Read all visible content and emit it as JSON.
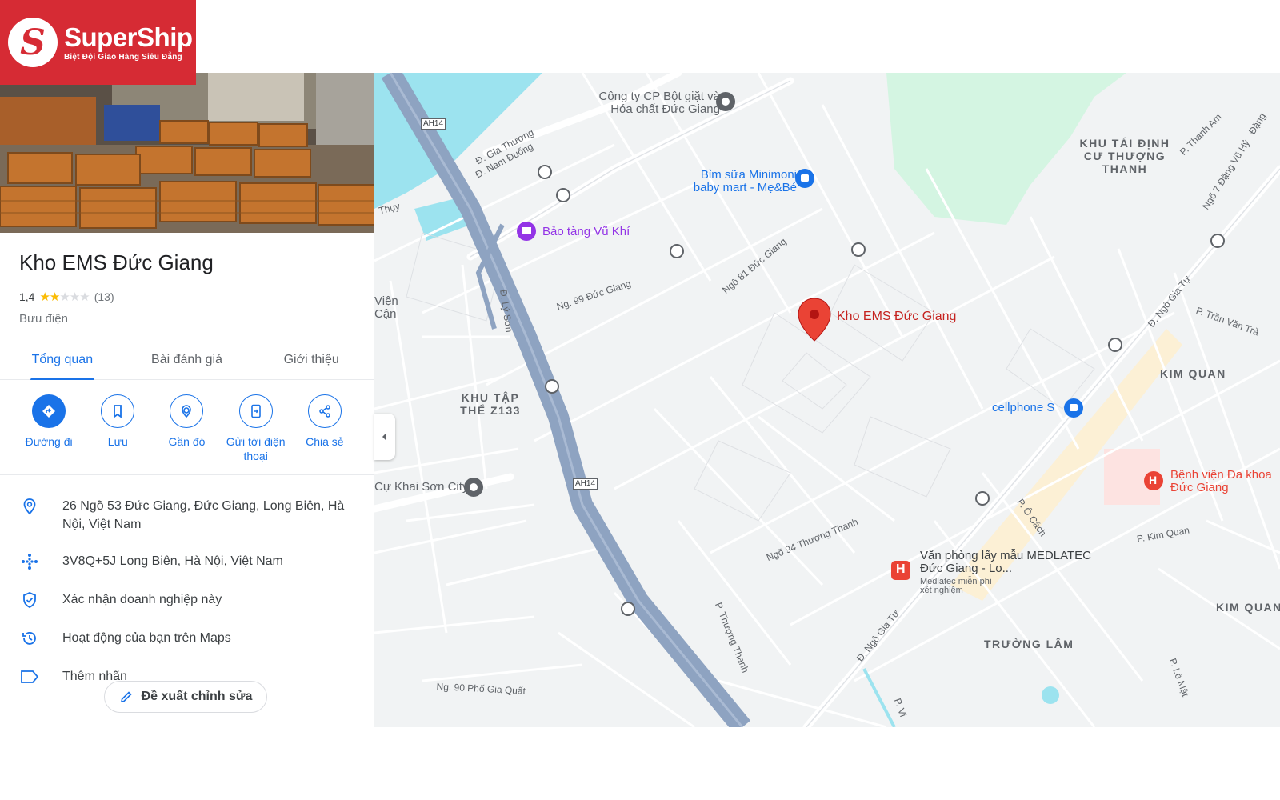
{
  "logo": {
    "mark": "S",
    "name": "SuperShip",
    "tagline": "Biệt Đội Giao Hàng Siêu Đẳng",
    "color": "#d62b34"
  },
  "place": {
    "name": "Kho EMS Đức Giang",
    "rating": "1,4",
    "rating_value": 1.4,
    "review_count": "(13)",
    "category": "Bưu điện"
  },
  "tabs": [
    {
      "label": "Tổng quan",
      "active": true
    },
    {
      "label": "Bài đánh giá",
      "active": false
    },
    {
      "label": "Giới thiệu",
      "active": false
    }
  ],
  "actions": [
    {
      "label": "Đường đi",
      "icon": "directions-icon"
    },
    {
      "label": "Lưu",
      "icon": "bookmark-icon"
    },
    {
      "label": "Gần đó",
      "icon": "nearby-icon"
    },
    {
      "label": "Gửi tới điện thoại",
      "icon": "send-to-phone-icon"
    },
    {
      "label": "Chia sẻ",
      "icon": "share-icon"
    }
  ],
  "info": [
    {
      "text": "26 Ngõ 53 Đức Giang, Đức Giang, Long Biên, Hà Nội, Việt Nam",
      "icon": "location-pin-icon"
    },
    {
      "text": "3V8Q+5J Long Biên, Hà Nội, Việt Nam",
      "icon": "plus-code-icon"
    },
    {
      "text": "Xác nhận doanh nghiệp này",
      "icon": "verified-shield-icon"
    },
    {
      "text": "Hoạt động của bạn trên Maps",
      "icon": "history-icon"
    },
    {
      "text": "Thêm nhãn",
      "icon": "label-icon"
    }
  ],
  "suggest_edit": "Đề xuất chỉnh sửa",
  "colors": {
    "accent": "#1a73e8",
    "marker": "#ea4335",
    "poi_blue": "#1a73e8",
    "poi_purple": "#9334e6",
    "poi_hospital": "#ea4335",
    "water": "#9ce3ef",
    "park": "#d4f5e2",
    "highway": "#8ea3c1"
  },
  "map": {
    "marker_label": "Kho EMS Đức Giang",
    "areas": {
      "khu_tai_dinh_cu": "KHU TÁI ĐỊNH CƯ THƯỢNG THANH",
      "kim_quan_1": "KIM QUAN",
      "kim_quan_2": "KIM QUAN",
      "khu_tap_the": "KHU TẬP THỂ Z133",
      "truong_lam": "TRƯỜNG LÂM"
    },
    "pois": {
      "cong_ty": "Công ty CP Bột giặt và Hóa chất Đức Giang",
      "bim_sua": "Bỉm sữa Minimoni baby mart - Mẹ&Bé",
      "bao_tang": "Bảo tàng Vũ Khí",
      "cellphone": "cellphone S",
      "benh_vien": "Bệnh viện Đa khoa Đức Giang",
      "medlatec": "Văn phòng lấy mẫu MEDLATEC Đức Giang - Lo...",
      "medlatec_sub": "Medlatec miễn phí xét nghiệm",
      "cu_khai": "Cự Khai Sơn City",
      "vien_can": "Viện Cận"
    },
    "streets": {
      "gia_thuong": "Đ. Gia Thượng",
      "nam_duong": "Đ. Nam Đuống",
      "ngo_99": "Ng. 99 Đức Giang",
      "ngo_81": "Ngõ 81 Đức Giang",
      "ly_son": "Đ. Lý Sơn",
      "ngo_gia_tu_1": "Đ. Ngô Gia Tự",
      "ngo_gia_tu_2": "Đ. Ngô Gia Tự",
      "ngo_94": "Ngõ 94 Thượng Thanh",
      "thuong_thanh": "P. Thượng Thanh",
      "ngo_90": "Ng. 90 Phố Gia Quất",
      "o_cach": "P. Ô Cách",
      "kim_quan_st": "P. Kim Quan",
      "tran_van_tra": "P. Trần Văn Trà",
      "thanh_am": "P. Thanh Am",
      "le_mat": "P. Lê Mật",
      "ngo_7": "Ngõ 7 Đặng Vũ Hỷ",
      "thuy": "Thụy",
      "dang": "Đặng",
      "p_vi": "P. Vi"
    },
    "shields": [
      "AH14",
      "AH14"
    ]
  }
}
